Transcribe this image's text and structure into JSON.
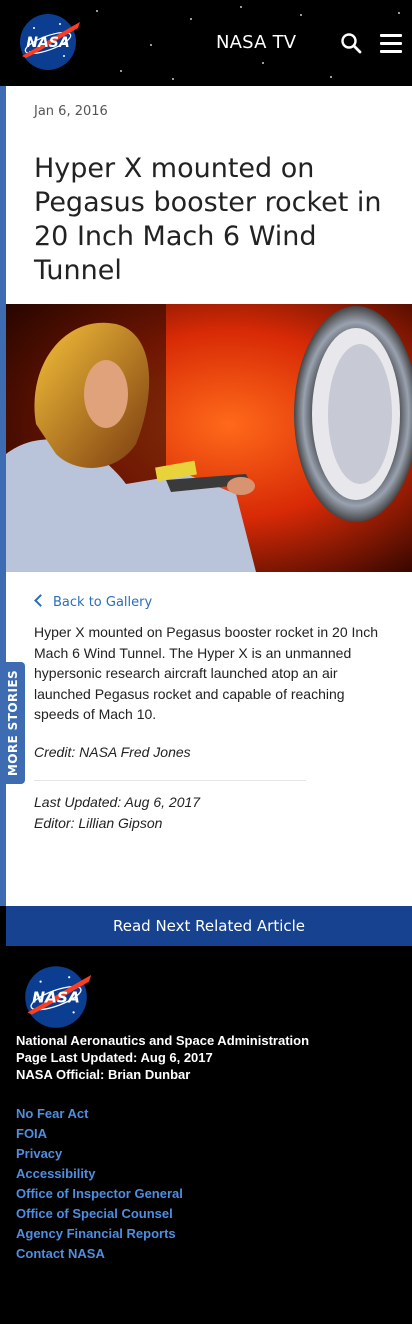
{
  "header": {
    "logo_text": "NASA",
    "nasa_tv_label": "NASA TV"
  },
  "article": {
    "date": "Jan 6, 2016",
    "title": "Hyper X mounted on Pegasus booster rocket in 20 Inch Mach 6 Wind Tunnel",
    "back_label": "Back to Gallery",
    "description": "Hyper X mounted on Pegasus booster rocket in 20 Inch Mach 6 Wind Tunnel. The Hyper X is an unmanned hypersonic research aircraft launched atop an air launched Pegasus rocket and capable of reaching speeds of Mach 10.",
    "credit": "Credit: NASA Fred Jones",
    "last_updated": "Last Updated: Aug 6, 2017",
    "editor": "Editor: Lillian Gipson"
  },
  "more_stories_label": "MORE STORIES",
  "read_next_label": "Read Next Related Article",
  "footer": {
    "org": "National Aeronautics and Space Administration",
    "page_updated": "Page Last Updated: Aug 6, 2017",
    "official": "NASA Official: Brian Dunbar",
    "links": [
      "No Fear Act",
      "FOIA",
      "Privacy",
      "Accessibility",
      "Office of Inspector General",
      "Office of Special Counsel",
      "Agency Financial Reports",
      "Contact NASA"
    ]
  },
  "colors": {
    "accent_blue": "#3d6cb3",
    "read_next_bg": "#16428f",
    "link_blue": "#2a6eb8",
    "footer_link": "#4f8ee0",
    "nasa_red": "#fc3d21",
    "nasa_blue": "#0b3d91"
  },
  "icons": {
    "search": "search-icon",
    "menu": "hamburger-menu-icon",
    "back": "chevron-left-icon"
  }
}
